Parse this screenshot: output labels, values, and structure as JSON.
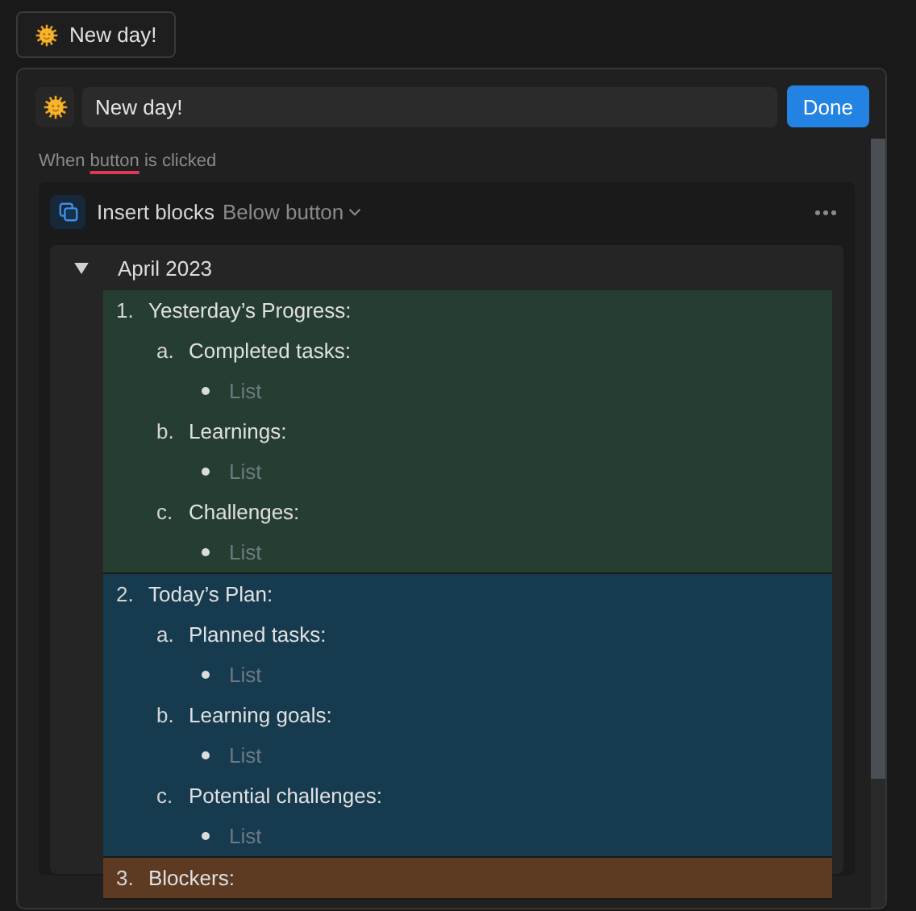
{
  "tab": {
    "title": "New day!"
  },
  "editor": {
    "title_value": "New day!",
    "done_label": "Done",
    "trigger": "When **button** is clicked",
    "action": {
      "label": "Insert blocks",
      "position": "Below button"
    },
    "toggle": {
      "title": "April 2023",
      "expanded": true,
      "sections": [
        {
          "number": "1.",
          "title": "Yesterday’s Progress:",
          "color": "#263d32",
          "items": [
            {
              "letter": "a.",
              "title": "Completed tasks:",
              "placeholder": "List"
            },
            {
              "letter": "b.",
              "title": "Learnings:",
              "placeholder": "List"
            },
            {
              "letter": "c.",
              "title": "Challenges:",
              "placeholder": "List"
            }
          ]
        },
        {
          "number": "2.",
          "title": "Today’s Plan:",
          "color": "#163a4e",
          "items": [
            {
              "letter": "a.",
              "title": "Planned tasks:",
              "placeholder": "List"
            },
            {
              "letter": "b.",
              "title": "Learning goals:",
              "placeholder": "List"
            },
            {
              "letter": "c.",
              "title": "Potential challenges:",
              "placeholder": "List"
            }
          ]
        },
        {
          "number": "3.",
          "title": "Blockers:",
          "color": "#5c3b22"
        }
      ]
    }
  }
}
